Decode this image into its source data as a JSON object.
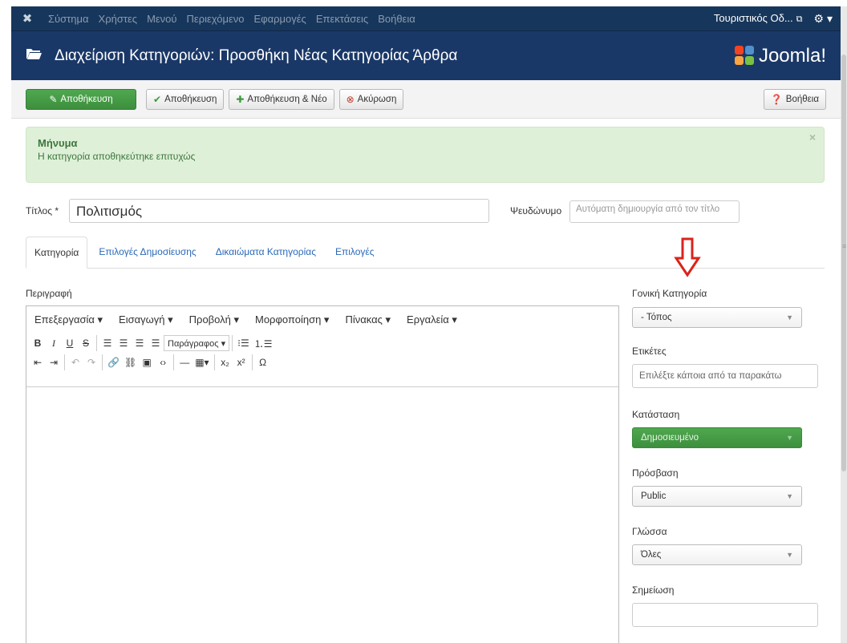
{
  "topbar": {
    "logo_icon": "joomla-icon",
    "menu": [
      "Σύστημα",
      "Χρήστες",
      "Μενού",
      "Περιεχόμενο",
      "Εφαρμογές",
      "Επεκτάσεις",
      "Βοήθεια"
    ],
    "site_name": "Τουριστικός Οδ...",
    "site_link_icon": "external-link-icon",
    "settings_icon": "gear-icon"
  },
  "header": {
    "folder_icon": "folder-open-icon",
    "title": "Διαχείριση Κατηγοριών: Προσθήκη Νέας Κατηγορίας Άρθρα",
    "brand": "Joomla!"
  },
  "toolbar": {
    "save_label": "Αποθήκευση",
    "save_close_label": "Αποθήκευση",
    "save_new_label": "Αποθήκευση & Νέο",
    "cancel_label": "Ακύρωση",
    "help_label": "Βοήθεια"
  },
  "message": {
    "heading": "Μήνυμα",
    "text": "Η κατηγορία αποθηκεύτηκε επιτυχώς",
    "close": "×"
  },
  "form": {
    "title_label": "Τίτλος *",
    "title_value": "Πολιτισμός",
    "alias_label": "Ψευδώνυμο",
    "alias_placeholder": "Αυτόματη δημιουργία από τον τίτλο"
  },
  "tabs": [
    "Κατηγορία",
    "Επιλογές Δημοσίευσης",
    "Δικαιώματα Κατηγορίας",
    "Επιλογές"
  ],
  "editor": {
    "label": "Περιγραφή",
    "menus": [
      "Επεξεργασία ▾",
      "Εισαγωγή ▾",
      "Προβολή ▾",
      "Μορφοποίηση ▾",
      "Πίνακας ▾",
      "Εργαλεία ▾"
    ],
    "format_select": "Παράγραφος ▾"
  },
  "sidebar": {
    "parent_label": "Γονική Κατηγορία",
    "parent_value": "- Τόπος",
    "tags_label": "Ετικέτες",
    "tags_placeholder": "Επιλέξτε κάποια από τα παρακάτω",
    "status_label": "Κατάσταση",
    "status_value": "Δημοσιευμένο",
    "access_label": "Πρόσβαση",
    "access_value": "Public",
    "language_label": "Γλώσσα",
    "language_value": "Όλες",
    "note_label": "Σημείωση",
    "note_value": ""
  },
  "colors": {
    "topbar": "#17365b",
    "header": "#1a3867",
    "success": "#46a546",
    "link": "#2a69b8",
    "annotation": "#d9241c"
  }
}
